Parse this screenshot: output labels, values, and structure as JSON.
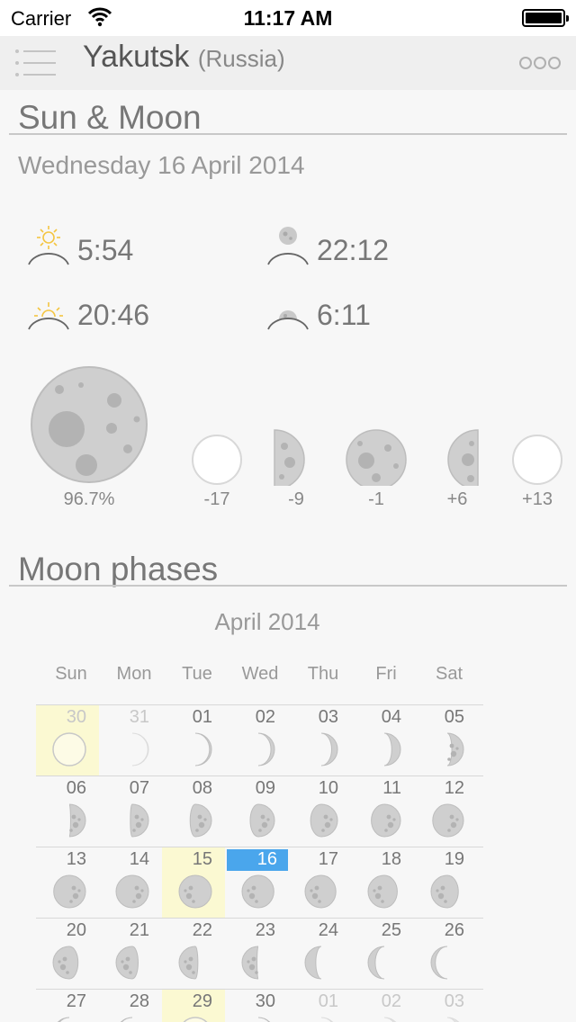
{
  "status": {
    "carrier": "Carrier",
    "time": "11:17 AM"
  },
  "nav": {
    "city": "Yakutsk",
    "country": "(Russia)"
  },
  "sun_moon": {
    "title": "Sun & Moon",
    "date": "Wednesday 16 April 2014",
    "sunrise": "5:54",
    "sunset": "20:46",
    "moonrise": "22:12",
    "moonset": "6:11"
  },
  "phases": {
    "current": "96.7%",
    "items": [
      {
        "label": "-17",
        "phase": "new"
      },
      {
        "label": "-9",
        "phase": "first-quarter"
      },
      {
        "label": "-1",
        "phase": "full"
      },
      {
        "label": "+6",
        "phase": "last-quarter"
      },
      {
        "label": "+13",
        "phase": "new"
      }
    ]
  },
  "moon_phases": {
    "title": "Moon phases",
    "month": "April 2014",
    "weekdays": [
      "Sun",
      "Mon",
      "Tue",
      "Wed",
      "Thu",
      "Fri",
      "Sat"
    ],
    "weeks": [
      [
        {
          "day": "30",
          "other": true,
          "illum": 0.0,
          "waxing": true,
          "hl": true
        },
        {
          "day": "31",
          "other": true,
          "illum": 0.02,
          "waxing": true
        },
        {
          "day": "01",
          "illum": 0.06,
          "waxing": true
        },
        {
          "day": "02",
          "illum": 0.11,
          "waxing": true
        },
        {
          "day": "03",
          "illum": 0.18,
          "waxing": true
        },
        {
          "day": "04",
          "illum": 0.27,
          "waxing": true
        },
        {
          "day": "05",
          "illum": 0.36,
          "waxing": true
        }
      ],
      [
        {
          "day": "06",
          "illum": 0.46,
          "waxing": true
        },
        {
          "day": "07",
          "illum": 0.56,
          "waxing": true
        },
        {
          "day": "08",
          "illum": 0.66,
          "waxing": true
        },
        {
          "day": "09",
          "illum": 0.75,
          "waxing": true
        },
        {
          "day": "10",
          "illum": 0.83,
          "waxing": true
        },
        {
          "day": "11",
          "illum": 0.9,
          "waxing": true
        },
        {
          "day": "12",
          "illum": 0.95,
          "waxing": true
        }
      ],
      [
        {
          "day": "13",
          "illum": 0.98,
          "waxing": true
        },
        {
          "day": "14",
          "illum": 1.0,
          "waxing": true
        },
        {
          "day": "15",
          "illum": 1.0,
          "waxing": false,
          "hl": true
        },
        {
          "day": "16",
          "illum": 0.98,
          "waxing": false,
          "today": true
        },
        {
          "day": "17",
          "illum": 0.95,
          "waxing": false
        },
        {
          "day": "18",
          "illum": 0.9,
          "waxing": false
        },
        {
          "day": "19",
          "illum": 0.84,
          "waxing": false
        }
      ],
      [
        {
          "day": "20",
          "illum": 0.77,
          "waxing": false
        },
        {
          "day": "21",
          "illum": 0.68,
          "waxing": false
        },
        {
          "day": "22",
          "illum": 0.58,
          "waxing": false
        },
        {
          "day": "23",
          "illum": 0.46,
          "waxing": false
        },
        {
          "day": "24",
          "illum": 0.33,
          "waxing": false
        },
        {
          "day": "25",
          "illum": 0.22,
          "waxing": false
        },
        {
          "day": "26",
          "illum": 0.13,
          "waxing": false
        }
      ],
      [
        {
          "day": "27",
          "illum": 0.07,
          "waxing": false
        },
        {
          "day": "28",
          "illum": 0.03,
          "waxing": false
        },
        {
          "day": "29",
          "illum": 0.0,
          "waxing": true,
          "hl": true
        },
        {
          "day": "30",
          "illum": 0.02,
          "waxing": true
        },
        {
          "day": "01",
          "other": true,
          "illum": 0.05,
          "waxing": true
        },
        {
          "day": "02",
          "other": true,
          "illum": 0.1,
          "waxing": true
        },
        {
          "day": "03",
          "other": true,
          "illum": 0.16,
          "waxing": true
        }
      ]
    ]
  },
  "colors": {
    "accent": "#4aa6ec",
    "highlight": "#fbf9d2",
    "sun": "#f4c542",
    "moon": "#c9c9c9"
  }
}
